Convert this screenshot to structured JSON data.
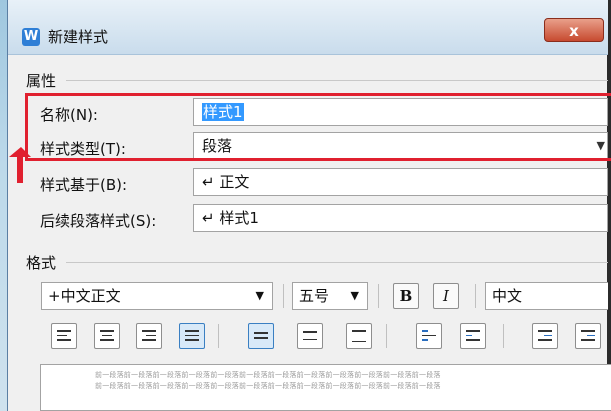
{
  "dialog": {
    "title": "新建样式",
    "close_label": "x",
    "app_icon": "W"
  },
  "properties": {
    "heading": "属性",
    "name_label": "名称(N):",
    "name_value": "样式1",
    "type_label": "样式类型(T):",
    "type_value": "段落",
    "based_on_label": "样式基于(B):",
    "based_on_value": "↵ 正文",
    "next_label": "后续段落样式(S):",
    "next_value": "↵ 样式1"
  },
  "format": {
    "heading": "格式",
    "font_value": "+中文正文",
    "size_value": "五号",
    "bold_label": "B",
    "italic_label": "I",
    "script_value": "中文"
  },
  "preview": {
    "line1": "前一段落前一段落前一段落前一段落前一段落前一段落前一段落前一段落前一段落前一段落前一段落前一段落",
    "line2": "前一段落前一段落前一段落前一段落前一段落前一段落前一段落前一段落前一段落前一段落前一段落前一段落"
  },
  "colors": {
    "highlight": "#e0202f",
    "selection": "#3399ff"
  }
}
